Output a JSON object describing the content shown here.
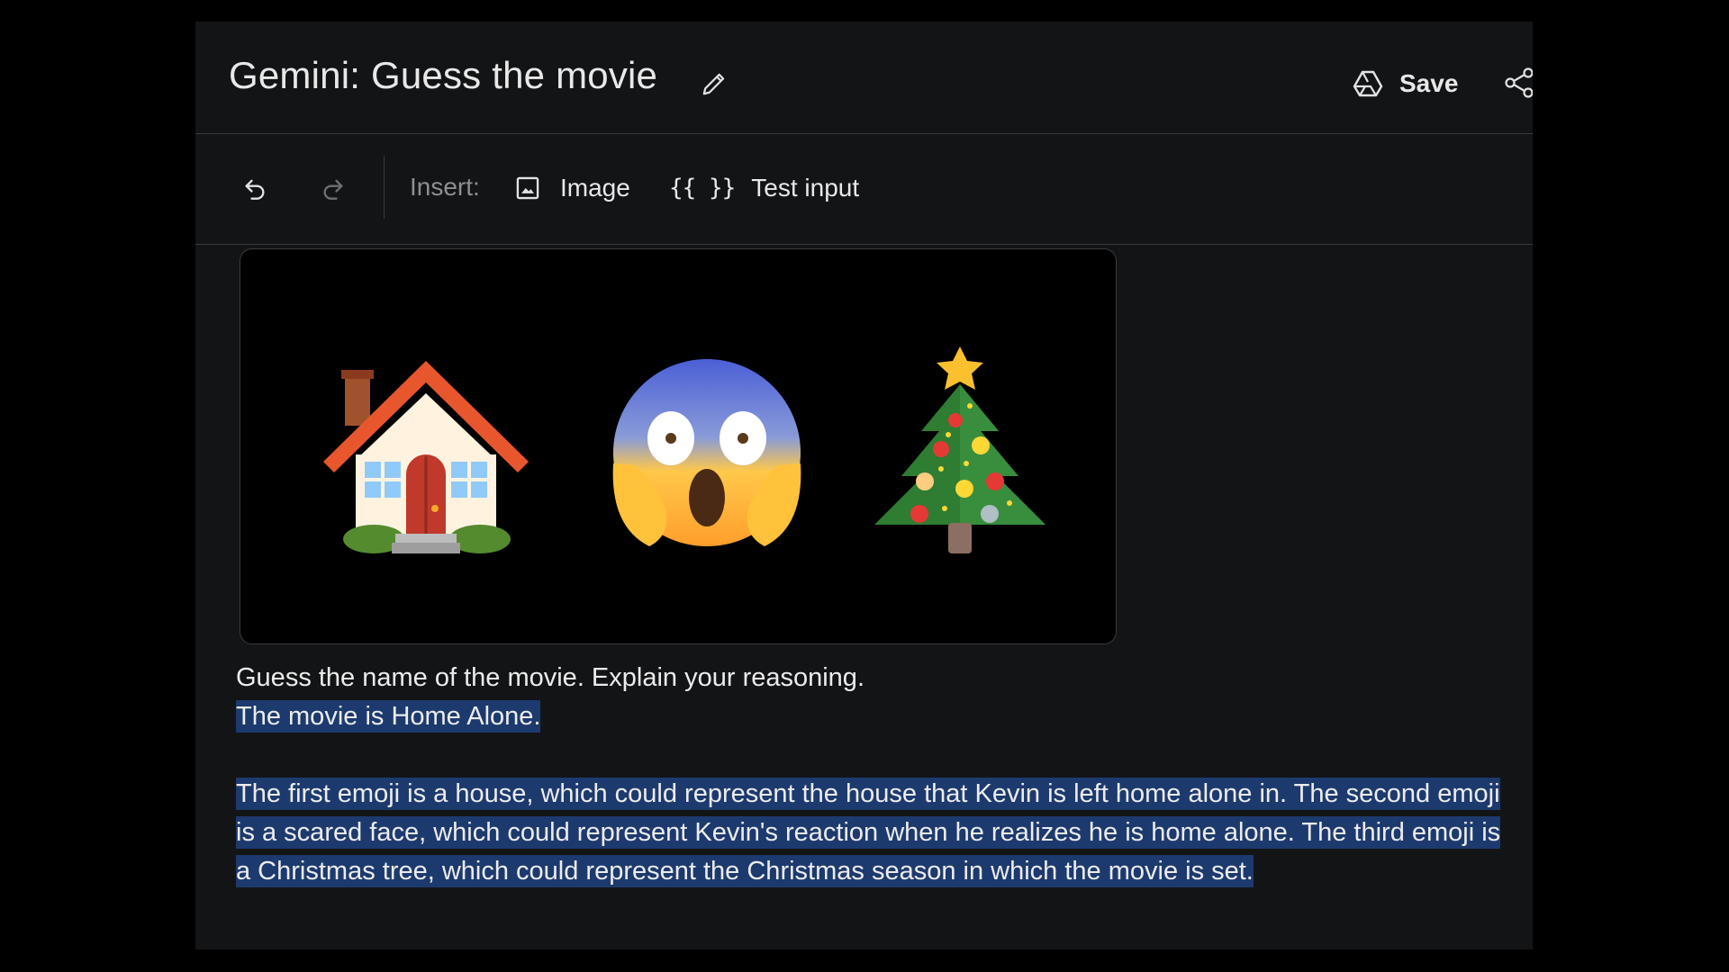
{
  "header": {
    "title": "Gemini: Guess the movie",
    "save_label": "Save",
    "icons": [
      "pencil-icon",
      "drive-icon",
      "share-icon"
    ]
  },
  "toolbar": {
    "insert_label": "Insert:",
    "image_label": "Image",
    "test_input_braces": "{{ }}",
    "test_input_label": "Test input",
    "icons": [
      "undo-icon",
      "redo-icon",
      "image-icon"
    ]
  },
  "image_card": {
    "emojis": [
      "house-emoji",
      "screaming-face-emoji",
      "christmas-tree-emoji"
    ]
  },
  "content": {
    "prompt": "Guess the name of the movie. Explain your reasoning.",
    "answer": " The movie is Home Alone.",
    "reasoning": "The first emoji is a house, which could represent the house that Kevin is left home alone in. The second emoji is a scared face, which could represent Kevin's reaction when he realizes he is home alone. The third emoji is a Christmas tree, which could represent the Christmas season in which the movie is set."
  },
  "colors": {
    "page_bg": "#000000",
    "app_bg": "#131416",
    "highlight": "#1d3a6e",
    "divider": "#3a3b3e"
  }
}
